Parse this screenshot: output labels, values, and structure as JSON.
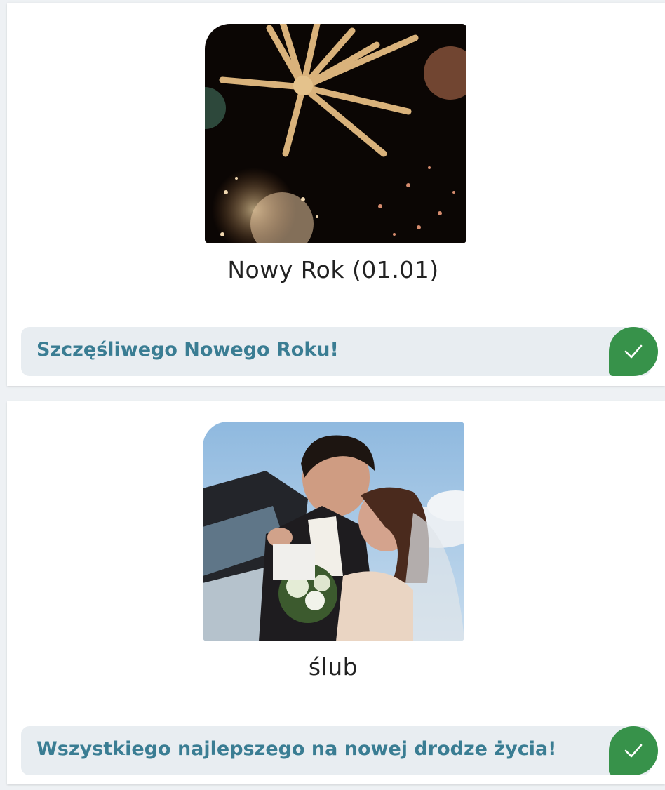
{
  "cards": [
    {
      "title": "Nowy Rok (01.01)",
      "image": "fireworks",
      "wish": "Szczęśliwego Nowego Roku!",
      "selected": true
    },
    {
      "title": "ślub",
      "image": "wedding-kiss",
      "wish": "Wszystkiego najlepszego na nowej drodze życia!",
      "selected": true
    }
  ],
  "colors": {
    "accent_green": "#37924a",
    "wish_text": "#3a7d93",
    "wish_background": "#e8edf1"
  },
  "icons": {
    "check": "check-icon"
  }
}
